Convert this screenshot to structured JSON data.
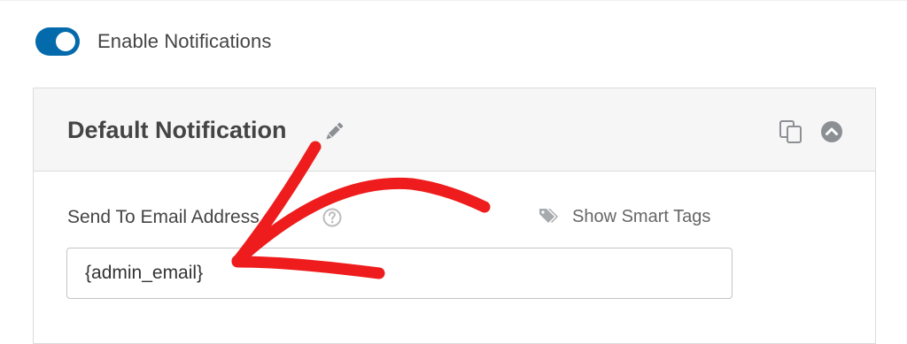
{
  "notifications": {
    "toggle_label": "Enable Notifications",
    "toggle_state": "on"
  },
  "panel": {
    "title": "Default Notification",
    "field_label": "Send To Email Address",
    "smart_tags_label": "Show Smart Tags",
    "email_value": "{admin_email}"
  },
  "icons": {
    "edit": "pencil-icon",
    "clone": "clone-icon",
    "collapse": "chevron-up-circle-icon",
    "help": "question-circle-icon",
    "tags": "tag-icon"
  },
  "colors": {
    "toggle_on": "#036aab",
    "annotation_arrow": "#ee1c1c",
    "panel_header_bg": "#f6f6f6"
  }
}
